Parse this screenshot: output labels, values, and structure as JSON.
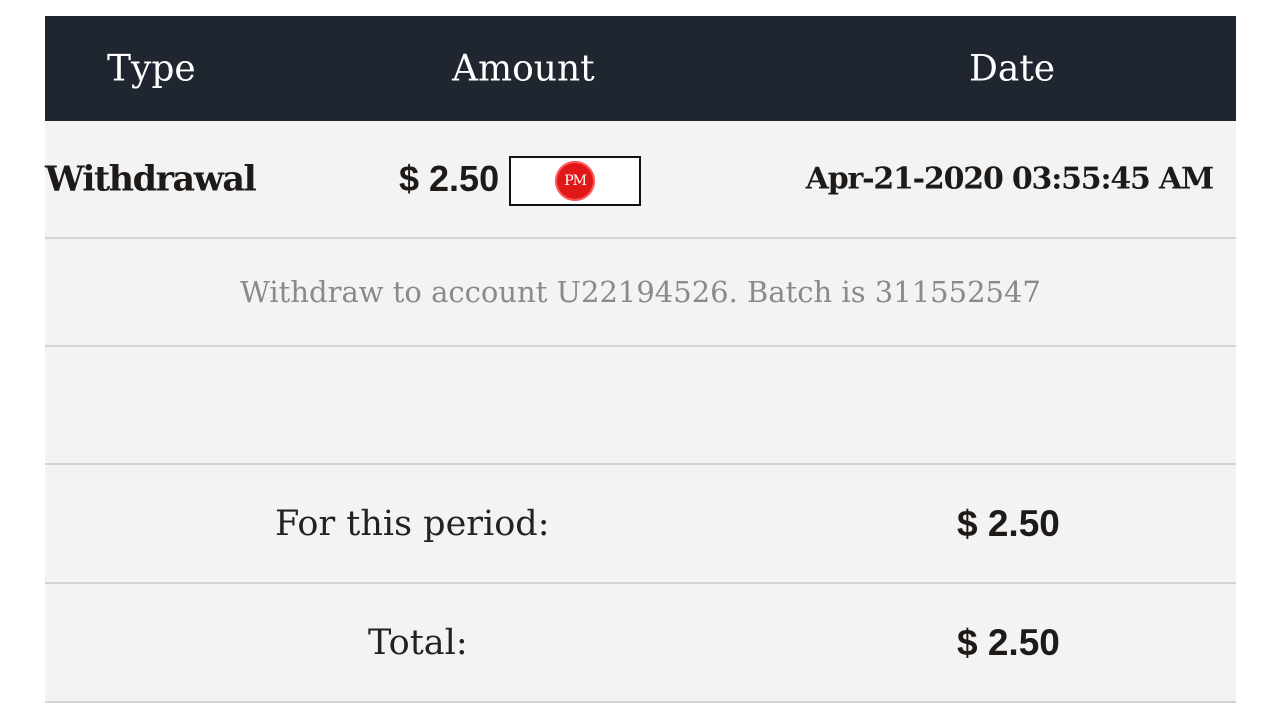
{
  "header": {
    "type": "Type",
    "amount": "Amount",
    "date": "Date"
  },
  "transaction": {
    "type": "Withdrawal",
    "amount": "$ 2.50",
    "payment_logo_text": "PM",
    "date": "Apr-21-2020 03:55:45 AM",
    "description": "Withdraw to account U22194526. Batch is 311552547"
  },
  "summary": {
    "period_label": "For this period:",
    "period_value": "$ 2.50",
    "total_label": "Total:",
    "total_value": "$ 2.50"
  },
  "colors": {
    "header_bg": "#1f2630",
    "row_bg": "#f3f3f3",
    "pm_logo": "#e01818"
  }
}
